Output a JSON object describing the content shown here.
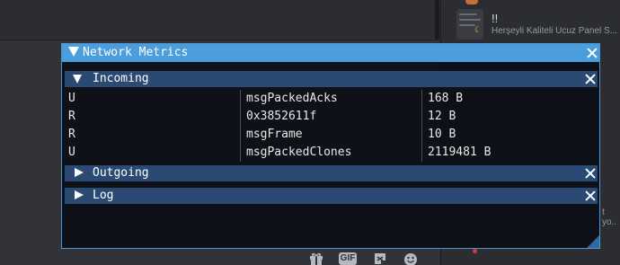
{
  "window": {
    "title": "Network Metrics"
  },
  "sections": {
    "incoming": {
      "label": "Incoming",
      "expanded": true,
      "rows": [
        {
          "type": "U",
          "name": "msgPackedAcks",
          "size": "168 B"
        },
        {
          "type": "R",
          "name": "0x3852611f",
          "size": "12 B"
        },
        {
          "type": "R",
          "name": "msgFrame",
          "size": "10 B"
        },
        {
          "type": "U",
          "name": "msgPackedClones",
          "size": "2119481 B"
        }
      ]
    },
    "outgoing": {
      "label": "Outgoing",
      "expanded": false
    },
    "log": {
      "label": "Log",
      "expanded": false
    }
  },
  "background_app": {
    "sidebar_title": "!!",
    "sidebar_subtitle": "Herşeyli Kaliteli Ucuz Panel S...",
    "sidebar_partial_text": "t yo..",
    "toolbar": {
      "gif_label": "GIF",
      "icons": [
        "gift-icon",
        "gif-icon",
        "sticker-icon",
        "emoji-icon"
      ]
    }
  },
  "colors": {
    "title_bar": "#4c9ddb",
    "header": "#2a4a74",
    "window_bg": "#0d1016",
    "window_border": "#4f95d1",
    "app_bg": "#313338"
  }
}
